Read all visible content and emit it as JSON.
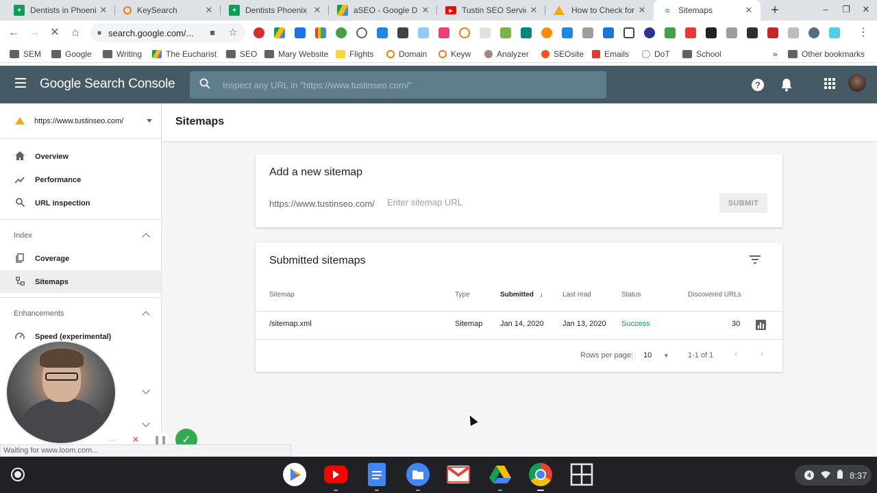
{
  "browser": {
    "tabs": [
      {
        "title": "Dentists in Phoenix",
        "favicon": "sheets-icon",
        "color": "#0f9d58",
        "glyph": "+"
      },
      {
        "title": "KeySearch",
        "favicon": "keysearch-icon",
        "color": "#f57c00",
        "glyph": "O"
      },
      {
        "title": "Dentists Phoenix -",
        "favicon": "sheets-icon",
        "color": "#0f9d58",
        "glyph": "+"
      },
      {
        "title": "aSEO - Google Drive",
        "favicon": "drive-icon",
        "color": "#fbbc04",
        "glyph": "▲"
      },
      {
        "title": "Tustin SEO Services",
        "favicon": "youtube-icon",
        "color": "#ff0000",
        "glyph": "▶"
      },
      {
        "title": "How to Check for G",
        "favicon": "warning-icon",
        "color": "#f9ab00",
        "glyph": "!"
      },
      {
        "title": "Sitemaps",
        "favicon": "search-console-icon",
        "color": "#4285f4",
        "glyph": "≈",
        "active": true
      }
    ],
    "url": "search.google.com/...",
    "bookmarks": [
      {
        "label": "SEM",
        "type": "folder"
      },
      {
        "label": "Google",
        "type": "folder"
      },
      {
        "label": "Writing",
        "type": "folder"
      },
      {
        "label": "The Eucharist",
        "type": "drive"
      },
      {
        "label": "SEO",
        "type": "folder"
      },
      {
        "label": "Mary Website",
        "type": "folder"
      },
      {
        "label": "Flights",
        "type": "plane"
      },
      {
        "label": "Domain",
        "type": "keysearch"
      },
      {
        "label": "Keyw",
        "type": "keysearch"
      },
      {
        "label": "Analyzer",
        "type": "face"
      },
      {
        "label": "SEOsite",
        "type": "star"
      },
      {
        "label": "Emails",
        "type": "red"
      },
      {
        "label": "DoT",
        "type": "ring"
      },
      {
        "label": "School",
        "type": "folder"
      }
    ],
    "bookmarks_more": "»",
    "other_bookmarks": "Other bookmarks"
  },
  "gsc": {
    "title": "Google Search Console",
    "search_placeholder": "Inspect any URL in \"https://www.tustinseo.com/\"",
    "property": "https://www.tustinseo.com/",
    "nav": {
      "overview": "Overview",
      "performance": "Performance",
      "url_inspection": "URL inspection",
      "index_header": "Index",
      "coverage": "Coverage",
      "sitemaps": "Sitemaps",
      "enhancements_header": "Enhancements",
      "speed": "Speed (experimental)"
    },
    "page_title": "Sitemaps",
    "add_card": {
      "title": "Add a new sitemap",
      "prefix": "https://www.tustinseo.com/",
      "placeholder": "Enter sitemap URL",
      "submit": "SUBMIT"
    },
    "submitted_card": {
      "title": "Submitted sitemaps",
      "columns": [
        "Sitemap",
        "Type",
        "Submitted",
        "Last read",
        "Status",
        "Discovered URLs"
      ],
      "rows": [
        {
          "sitemap": "/sitemap.xml",
          "type": "Sitemap",
          "submitted": "Jan 14, 2020",
          "last_read": "Jan 13, 2020",
          "status": "Success",
          "discovered": "30"
        }
      ],
      "rows_per_page_label": "Rows per page:",
      "rows_per_page": "10",
      "range": "1-1 of 1"
    }
  },
  "status_bar": "Waiting for www.loom.com...",
  "shelf": {
    "apps": [
      {
        "name": "play-store-icon",
        "color": "#34a853"
      },
      {
        "name": "youtube-icon",
        "color": "#ff0000"
      },
      {
        "name": "docs-icon",
        "color": "#4285f4"
      },
      {
        "name": "files-icon",
        "color": "#4285f4"
      },
      {
        "name": "gmail-icon",
        "color": "#ea4335"
      },
      {
        "name": "drive-icon",
        "color": "#fbbc04"
      },
      {
        "name": "chrome-icon",
        "color": "#db4437"
      },
      {
        "name": "apps-grid-icon",
        "color": "#e8eaed"
      }
    ],
    "notification_count": "4",
    "time": "8:37"
  },
  "colors": {
    "header": "#455a64",
    "success": "#0f9d58",
    "accent_property": "#f9ab00"
  }
}
